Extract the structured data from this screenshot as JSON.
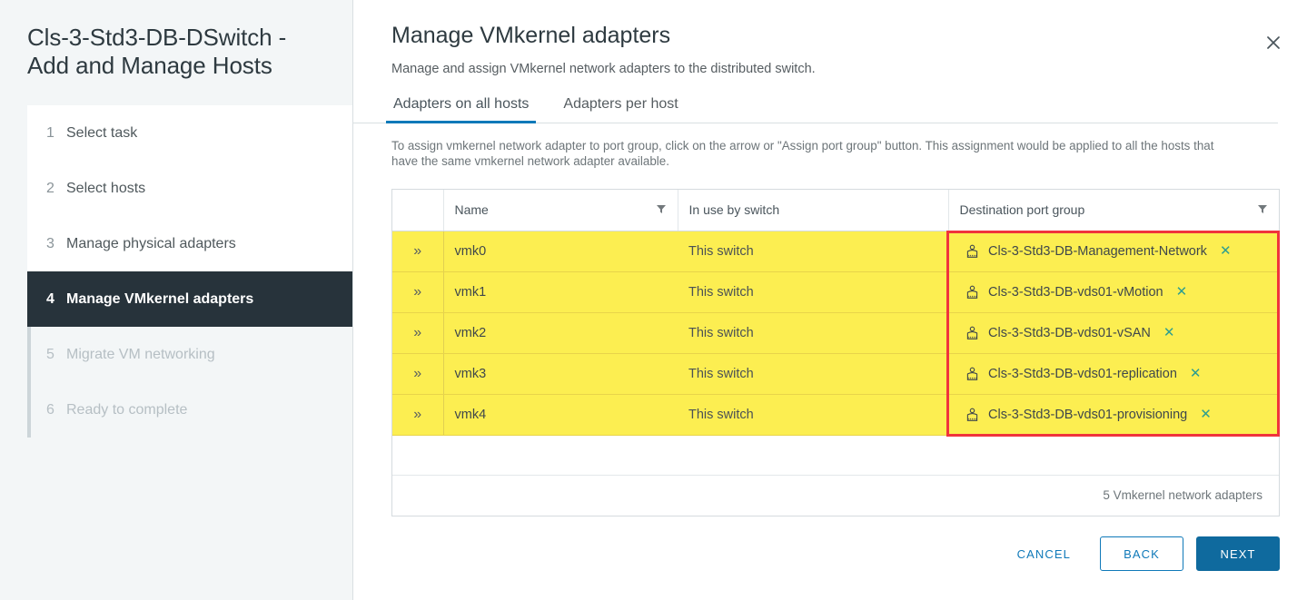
{
  "sidebar": {
    "title": "Cls-3-Std3-DB-DSwitch - Add and Manage Hosts",
    "steps": [
      {
        "num": "1",
        "label": "Select task",
        "state": "completed"
      },
      {
        "num": "2",
        "label": "Select hosts",
        "state": "completed"
      },
      {
        "num": "3",
        "label": "Manage physical adapters",
        "state": "completed"
      },
      {
        "num": "4",
        "label": "Manage VMkernel adapters",
        "state": "active"
      },
      {
        "num": "5",
        "label": "Migrate VM networking",
        "state": "upcoming"
      },
      {
        "num": "6",
        "label": "Ready to complete",
        "state": "upcoming"
      }
    ]
  },
  "main": {
    "title": "Manage VMkernel adapters",
    "subtitle": "Manage and assign VMkernel network adapters to the distributed switch.",
    "close_icon": "close-icon",
    "tabs": [
      {
        "label": "Adapters on all hosts",
        "active": true
      },
      {
        "label": "Adapters per host",
        "active": false
      }
    ],
    "instructions": "To assign vmkernel network adapter to port group, click on the arrow or \"Assign port group\" button. This assignment would be applied to all the hosts that have the same vmkernel network adapter available.",
    "table": {
      "columns": [
        {
          "key": "expand",
          "label": "",
          "filter": false
        },
        {
          "key": "name",
          "label": "Name",
          "filter": true
        },
        {
          "key": "switch",
          "label": "In use by switch",
          "filter": false
        },
        {
          "key": "dest",
          "label": "Destination port group",
          "filter": true
        }
      ],
      "expand_glyph": "»",
      "rows": [
        {
          "name": "vmk0",
          "switch": "This switch",
          "dest": "Cls-3-Std3-DB-Management-Network",
          "dest_icon": "port-group-icon",
          "remove_glyph": "✕"
        },
        {
          "name": "vmk1",
          "switch": "This switch",
          "dest": "Cls-3-Std3-DB-vds01-vMotion",
          "dest_icon": "port-group-icon",
          "remove_glyph": "✕"
        },
        {
          "name": "vmk2",
          "switch": "This switch",
          "dest": "Cls-3-Std3-DB-vds01-vSAN",
          "dest_icon": "port-group-icon",
          "remove_glyph": "✕"
        },
        {
          "name": "vmk3",
          "switch": "This switch",
          "dest": "Cls-3-Std3-DB-vds01-replication",
          "dest_icon": "port-group-icon",
          "remove_glyph": "✕"
        },
        {
          "name": "vmk4",
          "switch": "This switch",
          "dest": "Cls-3-Std3-DB-vds01-provisioning",
          "dest_icon": "port-group-icon",
          "remove_glyph": "✕"
        }
      ],
      "footer_count": "5 Vmkernel network adapters"
    },
    "buttons": {
      "cancel": "CANCEL",
      "back": "BACK",
      "next": "NEXT"
    }
  },
  "colors": {
    "accent_blue": "#0f79b9",
    "primary_button": "#0f6a9e",
    "highlight_yellow": "#fcee51",
    "callout_red": "#f0343c",
    "step_done_green": "#4f9400",
    "active_step_bg": "#27333b",
    "remove_teal": "#2f9e8f"
  }
}
